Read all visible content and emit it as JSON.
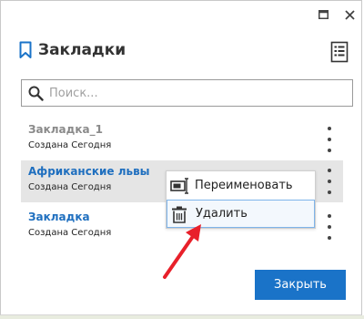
{
  "window": {
    "controls": [
      "maximize-icon",
      "close-icon"
    ]
  },
  "panel": {
    "title": "Закладки",
    "header_icon": "bookmark-icon",
    "list_icon": "document-list-icon"
  },
  "search": {
    "placeholder": "Поиск...",
    "value": "",
    "icon": "search-icon"
  },
  "bookmarks": [
    {
      "title": "Закладка_1",
      "subtitle": "Создана Сегодня",
      "title_color": "#8a8a8a",
      "selected": false
    },
    {
      "title": "Африканские львы",
      "subtitle": "Создана Сегодня",
      "title_color": "#1f6fbf",
      "selected": true
    },
    {
      "title": "Закладка",
      "subtitle": "Создана Сегодня",
      "title_color": "#1f6fbf",
      "selected": false
    }
  ],
  "context_menu": {
    "items": [
      {
        "label": "Переименовать",
        "icon": "rename-icon",
        "highlighted": false
      },
      {
        "label": "Удалить",
        "icon": "trash-icon",
        "highlighted": true
      }
    ]
  },
  "footer": {
    "close_label": "Закрыть"
  },
  "colors": {
    "accent": "#1a73c8",
    "link": "#1f6fbf",
    "annotation_arrow": "#e8202a"
  }
}
